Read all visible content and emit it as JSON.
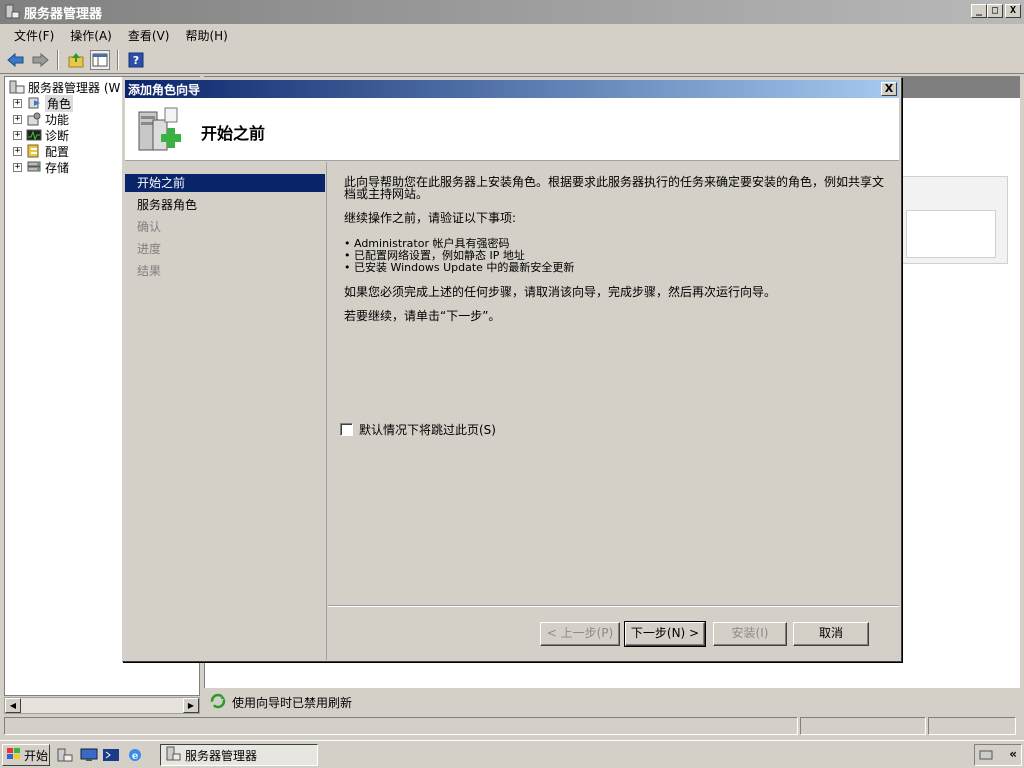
{
  "main_window": {
    "title": "服务器管理器",
    "controls": {
      "minimize": "_",
      "maximize": "□",
      "close": "X"
    }
  },
  "menubar": {
    "items": [
      {
        "label": "文件(F)"
      },
      {
        "label": "操作(A)"
      },
      {
        "label": "查看(V)"
      },
      {
        "label": "帮助(H)"
      }
    ]
  },
  "toolbar": {
    "buttons": [
      "back-arrow-icon",
      "forward-arrow-icon",
      "up-folder-icon",
      "show-hide-tree-icon",
      "help-icon"
    ]
  },
  "tree": {
    "root": "服务器管理器 (W",
    "items": [
      {
        "label": "角色",
        "icon": "roles-icon",
        "selected": true
      },
      {
        "label": "功能",
        "icon": "features-icon"
      },
      {
        "label": "诊断",
        "icon": "diagnostics-icon"
      },
      {
        "label": "配置",
        "icon": "configuration-icon"
      },
      {
        "label": "存储",
        "icon": "storage-icon"
      }
    ]
  },
  "status_refresh": "使用向导时已禁用刷新",
  "dialog": {
    "title": "添加角色向导",
    "header_title": "开始之前",
    "steps": [
      {
        "label": "开始之前",
        "state": "active"
      },
      {
        "label": "服务器角色",
        "state": "enabled"
      },
      {
        "label": "确认",
        "state": "disabled"
      },
      {
        "label": "进度",
        "state": "disabled"
      },
      {
        "label": "结果",
        "state": "disabled"
      }
    ],
    "content": {
      "intro": "此向导帮助您在此服务器上安装角色。根据要求此服务器执行的任务来确定要安装的角色，例如共享文档或主持网站。",
      "verify_heading": "继续操作之前，请验证以下事项:",
      "bullets": [
        "• Administrator 帐户具有强密码",
        "• 已配置网络设置，例如静态 IP 地址",
        "• 已安装 Windows Update 中的最新安全更新"
      ],
      "cancel_note": "如果您必须完成上述的任何步骤，请取消该向导，完成步骤，然后再次运行向导。",
      "continue_note": "若要继续，请单击“下一步”。"
    },
    "skip_checkbox": {
      "label": "默认情况下将跳过此页(S)",
      "checked": false
    },
    "buttons": {
      "prev": "< 上一步(P)",
      "next": "下一步(N) >",
      "install": "安装(I)",
      "cancel": "取消"
    },
    "close": "X"
  },
  "taskbar": {
    "start_label": "开始",
    "task_label": "服务器管理器",
    "tray_arrow": "«"
  }
}
